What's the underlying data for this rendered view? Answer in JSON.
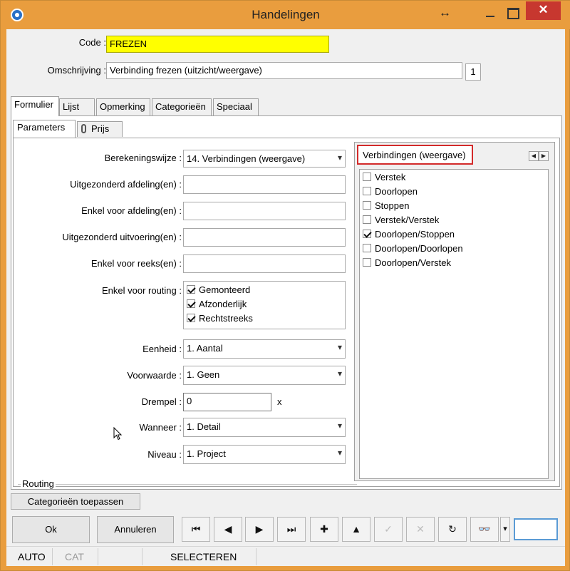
{
  "window": {
    "title": "Handelingen",
    "close_glyph": "✕",
    "resize_glyph": "↔"
  },
  "header": {
    "code_label": "Code :",
    "code_value": "FREZEN",
    "omschrijving_label": "Omschrijving :",
    "omschrijving_value": "Verbinding frezen (uitzicht/weergave)",
    "count": "1"
  },
  "tabs": [
    "Formulier",
    "Lijst",
    "Opmerking",
    "Categorieën",
    "Speciaal"
  ],
  "subtabs": [
    "Parameters",
    "Prijs"
  ],
  "form": {
    "berekeningswijze_label": "Berekeningswijze :",
    "berekeningswijze_value": "14. Verbindingen (weergave)",
    "uitgezonderd_afdeling_label": "Uitgezonderd afdeling(en) :",
    "uitgezonderd_afdeling_value": "",
    "enkel_afdeling_label": "Enkel voor afdeling(en) :",
    "enkel_afdeling_value": "",
    "uitgezonderd_uitvoering_label": "Uitgezonderd uitvoering(en) :",
    "uitgezonderd_uitvoering_value": "",
    "enkel_reeks_label": "Enkel voor reeks(en) :",
    "enkel_reeks_value": "",
    "routing_label": "Enkel voor routing :",
    "routing_items": [
      {
        "label": "Gemonteerd",
        "checked": true
      },
      {
        "label": "Afzonderlijk",
        "checked": true
      },
      {
        "label": "Rechtstreeks",
        "checked": true
      }
    ],
    "eenheid_label": "Eenheid :",
    "eenheid_value": "1. Aantal",
    "voorwaarde_label": "Voorwaarde :",
    "voorwaarde_value": "1. Geen",
    "drempel_label": "Drempel :",
    "drempel_value": "0",
    "drempel_unit": "x",
    "wanneer_label": "Wanneer :",
    "wanneer_value": "1. Detail",
    "niveau_label": "Niveau :",
    "niveau_value": "1. Project",
    "routing_group_label": "Routing"
  },
  "right_panel": {
    "header": "Verbindingen (weergave)",
    "arrow_left": "◀",
    "arrow_right": "▶",
    "items": [
      {
        "label": "Verstek",
        "checked": false
      },
      {
        "label": "Doorlopen",
        "checked": false
      },
      {
        "label": "Stoppen",
        "checked": false
      },
      {
        "label": "Verstek/Verstek",
        "checked": false
      },
      {
        "label": "Doorlopen/Stoppen",
        "checked": true
      },
      {
        "label": "Doorlopen/Doorlopen",
        "checked": false
      },
      {
        "label": "Doorlopen/Verstek",
        "checked": false
      }
    ]
  },
  "buttons": {
    "categorieen_toepassen": "Categorieën toepassen",
    "ok": "Ok",
    "annuleren": "Annuleren"
  },
  "toolbar_glyphs": {
    "first": "⏮",
    "prev": "◀",
    "next": "▶",
    "last": "⏭",
    "add": "✚",
    "up": "▲",
    "confirm": "✓",
    "cancel": "✕",
    "refresh": "↻",
    "find": "👓",
    "dropdown": "▾"
  },
  "status": {
    "auto": "AUTO",
    "cat": "CAT",
    "selecteren": "SELECTEREN"
  }
}
